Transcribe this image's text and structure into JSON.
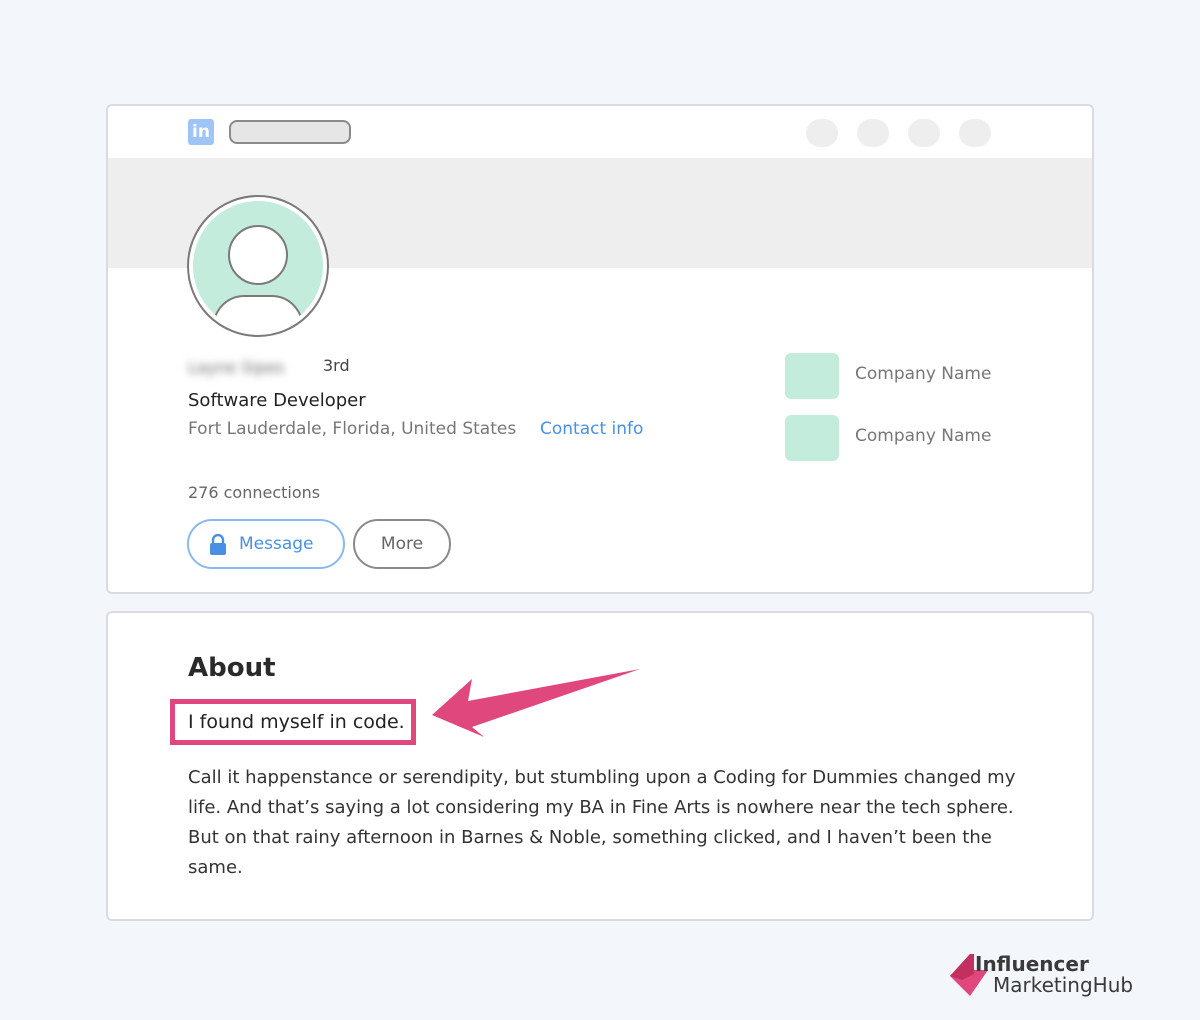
{
  "profile": {
    "logo_text": "in",
    "name": "Layne Sipes",
    "degree": "3rd",
    "headline": "Software Developer",
    "location": "Fort Lauderdale, Florida, United States",
    "contact_link": "Contact info",
    "connections": "276 connections",
    "message_button": "Message",
    "more_button": "More",
    "companies": [
      {
        "name": "Company Name"
      },
      {
        "name": "Company Name"
      }
    ]
  },
  "about": {
    "title": "About",
    "tagline": "I found myself in code.",
    "body": "Call it happenstance or serendipity, but stumbling upon a Coding for Dummies changed my life. And that’s saying a lot considering my BA in Fine Arts is nowhere near the tech sphere. But on that rainy afternoon in Barnes & Noble, something clicked, and I haven’t been the same."
  },
  "brand": {
    "line1": "Influencer",
    "line2": "MarketingHub"
  },
  "colors": {
    "accent_blue": "#4a90e2",
    "highlight_pink": "#e0477d",
    "avatar_mint": "#c3ecdd"
  },
  "icons": [
    "linkedin-logo-icon",
    "lock-icon",
    "user-avatar-icon",
    "arrow-icon"
  ]
}
